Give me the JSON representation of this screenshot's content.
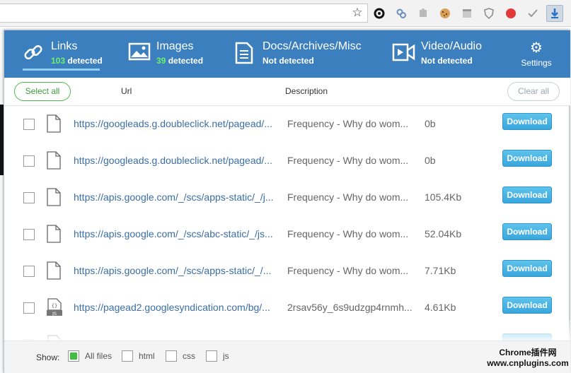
{
  "browser": {
    "star_icon": "star-icon",
    "extensions": [
      "gear-extension-icon",
      "link-extension-icon",
      "puzzle-extension-icon",
      "cookie-extension-icon",
      "layout-extension-icon",
      "shield-extension-icon",
      "red-extension-icon",
      "check-extension-icon",
      "download-extension-icon"
    ]
  },
  "tabs": [
    {
      "title": "Links",
      "count": "103",
      "detected": "detected",
      "icon": "link-icon"
    },
    {
      "title": "Images",
      "count": "39",
      "detected": "detected",
      "icon": "image-icon"
    },
    {
      "title": "Docs/Archives/Misc",
      "status": "Not detected",
      "icon": "document-icon"
    },
    {
      "title": "Video/Audio",
      "status": "Not detected",
      "icon": "video-icon"
    }
  ],
  "settings": {
    "label": "Settings",
    "icon": "gear-icon"
  },
  "toolbar": {
    "select_all": "Select all",
    "col_url": "Url",
    "col_description": "Description",
    "clear_all": "Clear all"
  },
  "rows": [
    {
      "url": "https://googleads.g.doubleclick.net/pagead/...",
      "description": "Frequency - Why do wom...",
      "size": "0b",
      "download": "Download",
      "icon": "file-icon"
    },
    {
      "url": "https://googleads.g.doubleclick.net/pagead/...",
      "description": "Frequency - Why do wom...",
      "size": "0b",
      "download": "Download",
      "icon": "file-icon"
    },
    {
      "url": "https://apis.google.com/_/scs/apps-static/_/j...",
      "description": "Frequency - Why do wom...",
      "size": "105.4Kb",
      "download": "Download",
      "icon": "file-icon"
    },
    {
      "url": "https://apis.google.com/_/scs/abc-static/_/js...",
      "description": "Frequency - Why do wom...",
      "size": "52.04Kb",
      "download": "Download",
      "icon": "file-icon"
    },
    {
      "url": "https://apis.google.com/_/scs/apps-static/_/...",
      "description": "Frequency - Why do wom...",
      "size": "7.71Kb",
      "download": "Download",
      "icon": "file-icon"
    },
    {
      "url": "https://pagead2.googlesyndication.com/bg/...",
      "description": "2rsav56y_6s9udzgp4rnmh...",
      "size": "4.61Kb",
      "download": "Download",
      "icon": "js-file-icon"
    }
  ],
  "footer": {
    "show_label": "Show:",
    "filters": [
      {
        "label": "All files",
        "checked": true
      },
      {
        "label": "html",
        "checked": false
      },
      {
        "label": "css",
        "checked": false
      },
      {
        "label": "js",
        "checked": false
      }
    ]
  },
  "watermark": {
    "line1": "Chrome插件网",
    "line2": "www.cnplugins.com"
  },
  "colors": {
    "header_bg": "#3b7fbf",
    "count_green": "#6ef06e",
    "download_blue": "#3aa6dd",
    "select_green": "#4cbb4c"
  }
}
